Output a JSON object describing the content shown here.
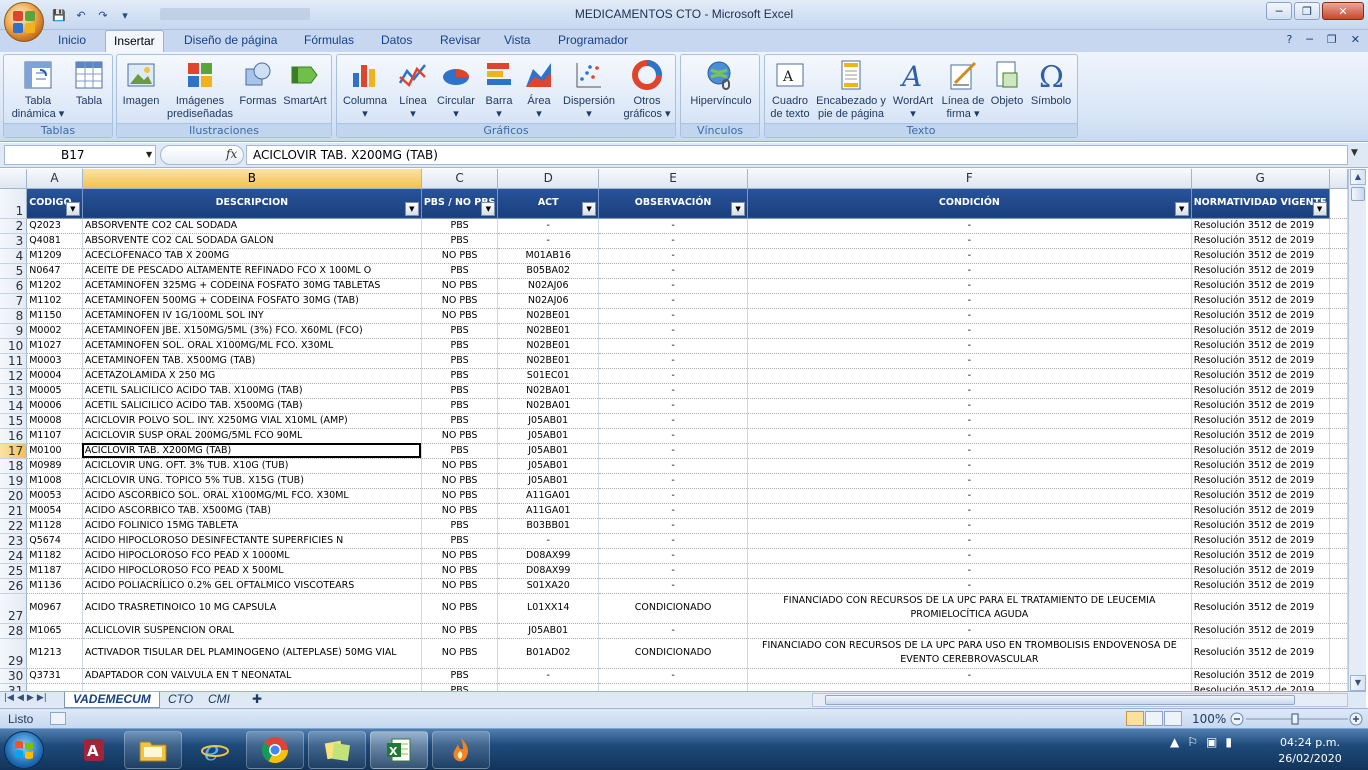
{
  "window": {
    "title": "MEDICAMENTOS CTO - Microsoft Excel",
    "controls": {
      "minimize": "─",
      "restore": "❐",
      "close": "✕"
    }
  },
  "qat": {
    "save": "💾",
    "undo": "↶",
    "redo": "↷",
    "customize": "▾"
  },
  "tabs": [
    "Inicio",
    "Insertar",
    "Diseño de página",
    "Fórmulas",
    "Datos",
    "Revisar",
    "Vista",
    "Programador"
  ],
  "active_tab": "Insertar",
  "help": {
    "help": "?",
    "min": "─",
    "restore": "❐",
    "close": "✕"
  },
  "ribbon": {
    "groups": [
      {
        "label": "Tablas",
        "buttons": [
          {
            "label": "Tabla\ndinámica ▾",
            "icon": "pivot-table-icon"
          },
          {
            "label": "Tabla",
            "icon": "table-icon"
          }
        ]
      },
      {
        "label": "Ilustraciones",
        "buttons": [
          {
            "label": "Imagen",
            "icon": "picture-icon"
          },
          {
            "label": "Imágenes\nprediseñadas",
            "icon": "clipart-icon"
          },
          {
            "label": "Formas",
            "icon": "shapes-icon"
          },
          {
            "label": "SmartArt",
            "icon": "smartart-icon"
          }
        ]
      },
      {
        "label": "Gráficos",
        "buttons": [
          {
            "label": "Columna\n▾",
            "icon": "column-chart-icon"
          },
          {
            "label": "Línea\n▾",
            "icon": "line-chart-icon"
          },
          {
            "label": "Circular\n▾",
            "icon": "pie-chart-icon"
          },
          {
            "label": "Barra\n▾",
            "icon": "bar-chart-icon"
          },
          {
            "label": "Área\n▾",
            "icon": "area-chart-icon"
          },
          {
            "label": "Dispersión\n▾",
            "icon": "scatter-chart-icon"
          },
          {
            "label": "Otros\ngráficos ▾",
            "icon": "other-charts-icon"
          }
        ]
      },
      {
        "label": "Vínculos",
        "buttons": [
          {
            "label": "Hipervínculo",
            "icon": "hyperlink-icon"
          }
        ]
      },
      {
        "label": "Texto",
        "buttons": [
          {
            "label": "Cuadro\nde texto",
            "icon": "textbox-icon"
          },
          {
            "label": "Encabezado y\npie de página",
            "icon": "header-footer-icon"
          },
          {
            "label": "WordArt\n▾",
            "icon": "wordart-icon"
          },
          {
            "label": "Línea de\nfirma ▾",
            "icon": "signature-line-icon"
          },
          {
            "label": "Objeto",
            "icon": "object-icon"
          },
          {
            "label": "Símbolo",
            "icon": "symbol-icon"
          }
        ]
      }
    ]
  },
  "formula_bar": {
    "name_box": "B17",
    "fx": "fx",
    "formula": "ACICLOVIR TAB. X200MG (TAB)"
  },
  "columns": [
    "A",
    "B",
    "C",
    "D",
    "E",
    "F",
    "G"
  ],
  "selected_column": "B",
  "selected_row": "17",
  "header_row": {
    "num": "1",
    "cells": [
      "CODIGO",
      "DESCRIPCION",
      "PBS / NO PBS",
      "ACT",
      "OBSERVACIÓN",
      "CONDICIÓN",
      "NORMATIVIDAD VIGENTE"
    ]
  },
  "rows": [
    {
      "n": "2",
      "c": [
        "Q2023",
        "ABSORVENTE CO2 CAL SODADA",
        "PBS",
        "-",
        "-",
        "-",
        "Resolución 3512 de 2019"
      ]
    },
    {
      "n": "3",
      "c": [
        "Q4081",
        "ABSORVENTE CO2 CAL SODADA GALON",
        "PBS",
        "-",
        "-",
        "-",
        "Resolución 3512 de 2019"
      ]
    },
    {
      "n": "4",
      "c": [
        "M1209",
        "ACECLOFENACO TAB X 200MG",
        "NO PBS",
        "M01AB16",
        "-",
        "-",
        "Resolución 3512 de 2019"
      ]
    },
    {
      "n": "5",
      "c": [
        "N0647",
        "ACEITE DE PESCADO ALTAMENTE REFINADO FCO X 100ML O",
        "PBS",
        "B05BA02",
        "-",
        "-",
        "Resolución 3512 de 2019"
      ]
    },
    {
      "n": "6",
      "c": [
        "M1202",
        "ACETAMINOFEN 325MG + CODEINA FOSFATO 30MG TABLETAS",
        "NO PBS",
        "N02AJ06",
        "-",
        "-",
        "Resolución 3512 de 2019"
      ]
    },
    {
      "n": "7",
      "c": [
        "M1102",
        "ACETAMINOFEN 500MG + CODEINA FOSFATO 30MG (TAB)",
        "NO PBS",
        "N02AJ06",
        "-",
        "-",
        "Resolución 3512 de 2019"
      ]
    },
    {
      "n": "8",
      "c": [
        "M1150",
        "ACETAMINOFEN IV 1G/100ML SOL INY",
        "NO PBS",
        "N02BE01",
        "-",
        "-",
        "Resolución 3512 de 2019"
      ]
    },
    {
      "n": "9",
      "c": [
        "M0002",
        "ACETAMINOFEN JBE. X150MG/5ML (3%) FCO. X60ML (FCO)",
        "PBS",
        "N02BE01",
        "-",
        "-",
        "Resolución 3512 de 2019"
      ]
    },
    {
      "n": "10",
      "c": [
        "M1027",
        "ACETAMINOFEN SOL. ORAL X100MG/ML FCO. X30ML",
        "PBS",
        "N02BE01",
        "-",
        "-",
        "Resolución 3512 de 2019"
      ]
    },
    {
      "n": "11",
      "c": [
        "M0003",
        "ACETAMINOFEN TAB. X500MG (TAB)",
        "PBS",
        "N02BE01",
        "-",
        "-",
        "Resolución 3512 de 2019"
      ]
    },
    {
      "n": "12",
      "c": [
        "M0004",
        "ACETAZOLAMIDA X 250 MG",
        "PBS",
        "S01EC01",
        "-",
        "-",
        "Resolución 3512 de 2019"
      ]
    },
    {
      "n": "13",
      "c": [
        "M0005",
        "ACETIL SALICILICO ACIDO TAB. X100MG (TAB)",
        "PBS",
        "N02BA01",
        "-",
        "-",
        "Resolución 3512 de 2019"
      ]
    },
    {
      "n": "14",
      "c": [
        "M0006",
        "ACETIL SALICILICO ACIDO TAB. X500MG (TAB)",
        "PBS",
        "N02BA01",
        "-",
        "-",
        "Resolución 3512 de 2019"
      ]
    },
    {
      "n": "15",
      "c": [
        "M0008",
        "ACICLOVIR POLVO SOL. INY. X250MG VIAL X10ML (AMP)",
        "PBS",
        "J05AB01",
        "-",
        "-",
        "Resolución 3512 de 2019"
      ]
    },
    {
      "n": "16",
      "c": [
        "M1107",
        "ACICLOVIR SUSP ORAL 200MG/5ML FCO 90ML",
        "NO PBS",
        "J05AB01",
        "-",
        "-",
        "Resolución 3512 de 2019"
      ]
    },
    {
      "n": "17",
      "c": [
        "M0100",
        "ACICLOVIR TAB. X200MG (TAB)",
        "PBS",
        "J05AB01",
        "-",
        "-",
        "Resolución 3512 de 2019"
      ]
    },
    {
      "n": "18",
      "c": [
        "M0989",
        "ACICLOVIR UNG. OFT. 3% TUB. X10G (TUB)",
        "NO PBS",
        "J05AB01",
        "-",
        "-",
        "Resolución 3512 de 2019"
      ]
    },
    {
      "n": "19",
      "c": [
        "M1008",
        "ACICLOVIR UNG. TOPICO 5% TUB. X15G (TUB)",
        "NO PBS",
        "J05AB01",
        "-",
        "-",
        "Resolución 3512 de 2019"
      ]
    },
    {
      "n": "20",
      "c": [
        "M0053",
        "ACIDO ASCORBICO SOL. ORAL X100MG/ML FCO. X30ML",
        "NO PBS",
        "A11GA01",
        "-",
        "-",
        "Resolución 3512 de 2019"
      ]
    },
    {
      "n": "21",
      "c": [
        "M0054",
        "ACIDO ASCORBICO TAB. X500MG (TAB)",
        "NO PBS",
        "A11GA01",
        "-",
        "-",
        "Resolución 3512 de 2019"
      ]
    },
    {
      "n": "22",
      "c": [
        "M1128",
        "ACIDO FOLINICO 15MG TABLETA",
        "PBS",
        "B03BB01",
        "-",
        "-",
        "Resolución 3512 de 2019"
      ]
    },
    {
      "n": "23",
      "c": [
        "Q5674",
        "ACIDO HIPOCLOROSO DESINFECTANTE SUPERFICIES N",
        "PBS",
        "-",
        "-",
        "-",
        "Resolución 3512 de 2019"
      ]
    },
    {
      "n": "24",
      "c": [
        "M1182",
        "ACIDO HIPOCLOROSO FCO PEAD X 1000ML",
        "NO PBS",
        "D08AX99",
        "-",
        "-",
        "Resolución 3512 de 2019"
      ]
    },
    {
      "n": "25",
      "c": [
        "M1187",
        "ACIDO HIPOCLOROSO FCO PEAD X 500ML",
        "NO PBS",
        "D08AX99",
        "-",
        "-",
        "Resolución 3512 de 2019"
      ]
    },
    {
      "n": "26",
      "c": [
        "M1136",
        "ACIDO POLIACRÍLICO 0.2% GEL OFTALMICO VISCOTEARS",
        "NO PBS",
        "S01XA20",
        "-",
        "-",
        "Resolución 3512 de 2019"
      ]
    },
    {
      "n": "27",
      "tall": true,
      "c": [
        "M0967",
        "ACIDO TRASRETINOICO 10 MG CAPSULA",
        "NO PBS",
        "L01XX14",
        "CONDICIONADO",
        "FINANCIADO CON RECURSOS DE LA UPC PARA EL TRATAMIENTO DE LEUCEMIA PROMIELOCÍTICA AGUDA",
        "Resolución 3512 de 2019"
      ]
    },
    {
      "n": "28",
      "c": [
        "M1065",
        "ACLICLOVIR SUSPENCION ORAL",
        "NO PBS",
        "J05AB01",
        "-",
        "-",
        "Resolución 3512 de 2019"
      ]
    },
    {
      "n": "29",
      "tall": true,
      "c": [
        "M1213",
        "ACTIVADOR TISULAR DEL PLAMINOGENO (ALTEPLASE) 50MG VIAL",
        "NO PBS",
        "B01AD02",
        "CONDICIONADO",
        "FINANCIADO CON RECURSOS DE LA UPC PARA USO EN TROMBOLISIS ENDOVENOSA DE EVENTO CEREBROVASCULAR",
        "Resolución 3512 de 2019"
      ]
    },
    {
      "n": "30",
      "c": [
        "Q3731",
        "ADAPTADOR CON VALVULA EN T NEONATAL",
        "PBS",
        "-",
        "-",
        "-",
        "Resolución 3512 de 2019"
      ]
    },
    {
      "n": "31",
      "c": [
        "",
        "",
        "PBS",
        "",
        "",
        "",
        "Resolución 3512 de 2019"
      ]
    }
  ],
  "sheets": [
    "VADEMECUM",
    "CTO",
    "CMI"
  ],
  "active_sheet": "VADEMECUM",
  "status": {
    "ready": "Listo",
    "zoom": "100%"
  },
  "clock": {
    "time": "04:24 p.m.",
    "date": "26/02/2020"
  },
  "colors": {
    "header_fill": "#1f4788",
    "selection": "#f3c150",
    "ribbon": "#d9e6f6"
  }
}
